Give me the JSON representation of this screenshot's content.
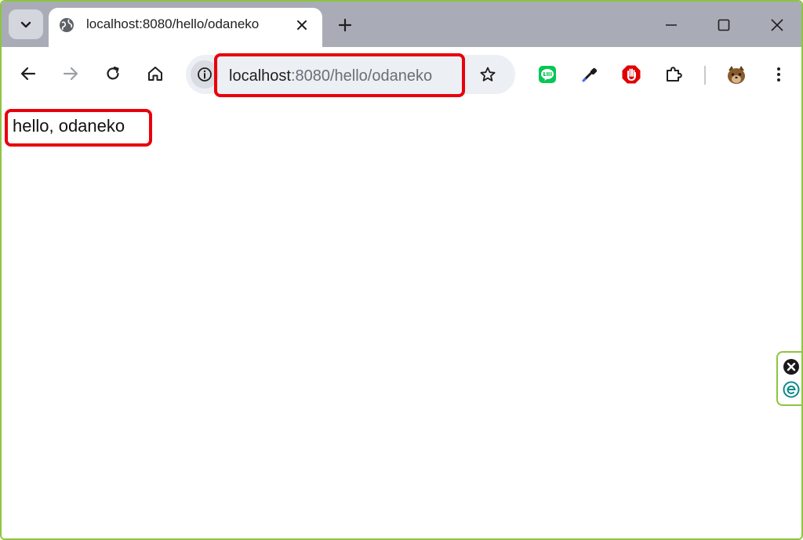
{
  "tab": {
    "title": "localhost:8080/hello/odaneko"
  },
  "omnibox": {
    "url_host": "localhost",
    "url_rest": ":8080/hello/odaneko"
  },
  "page": {
    "text": "hello, odaneko"
  },
  "colors": {
    "highlight": "#e8000b",
    "window_border": "#8cc63f",
    "tabstrip": "#a9acb6"
  },
  "icons": {
    "tab": "globe-icon",
    "extensions": [
      "line-icon",
      "eyedropper-icon",
      "stop-hand-icon",
      "puzzle-icon",
      "avatar-icon"
    ]
  }
}
